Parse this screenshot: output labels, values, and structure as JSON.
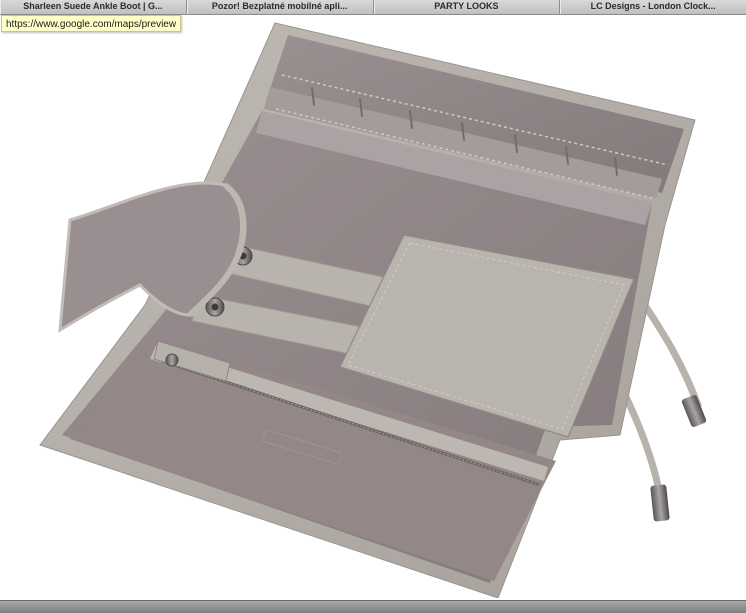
{
  "tabs": [
    {
      "label": "Sharleen Suede Ankle Boot | G..."
    },
    {
      "label": "Pozor! Bezplatné mobilné apli..."
    },
    {
      "label": "PARTY LOOKS"
    },
    {
      "label": "LC Designs - London Clock..."
    }
  ],
  "status": {
    "hover_url": "https://www.google.com/maps/preview"
  },
  "product": {
    "colors": {
      "leather": "#b3ada7",
      "suede": "#8f8383",
      "suede_light": "#a2999a",
      "edge": "#c6c1bb",
      "metal": "#7b7777"
    },
    "icons": [
      "snap-button-icon",
      "zipper-pull-icon",
      "cord-tip-icon"
    ]
  }
}
